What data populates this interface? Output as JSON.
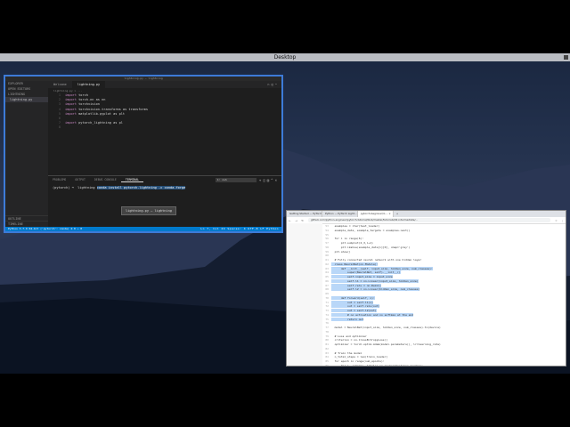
{
  "menubar": {
    "title": "Desktop"
  },
  "vscode": {
    "window_title": "lightning.py — lightning",
    "sidebar": {
      "header": "EXPLORER",
      "open_editors": "OPEN EDITORS",
      "folder": "LIGHTNING",
      "files": [
        "lightning.py"
      ],
      "outline": "OUTLINE",
      "timeline": "TIMELINE"
    },
    "tabs": [
      "Welcome",
      "lightning.py"
    ],
    "breadcrumb": "lightning.py > ...",
    "code_lines": [
      {
        "n": "1",
        "kw": "import",
        "rest": " torch"
      },
      {
        "n": "2",
        "kw": "import",
        "rest": " torch.nn as nn"
      },
      {
        "n": "3",
        "kw": "import",
        "rest": " torchvision"
      },
      {
        "n": "4",
        "kw": "import",
        "rest": " torchvision.transforms as transforms"
      },
      {
        "n": "5",
        "kw": "import",
        "rest": " matplotlib.pyplot as plt"
      },
      {
        "n": "6",
        "kw": "",
        "rest": ""
      },
      {
        "n": "7",
        "kw": "import",
        "rest": " pytorch_lightning as pl"
      },
      {
        "n": "8",
        "kw": "",
        "rest": ""
      }
    ],
    "hover_text": "lightning.py — lightning",
    "panel_tabs": [
      "PROBLEMS",
      "OUTPUT",
      "DEBUG CONSOLE",
      "TERMINAL"
    ],
    "terminal_select": "1: zsh",
    "terminal_prompt": "(pytorch) ➜  lightning ",
    "terminal_command": "conda install pytorch-lightning -c conda-forge",
    "status_left": "Python 3.7.9 64-bit ('pytorch': conda)   ⊗ 0 ⚠ 0",
    "status_right": "Ln 7, Col 24   Spaces: 4   UTF-8   LF   Python"
  },
  "browser": {
    "tabs": [
      "Getting Started — PyTorch",
      "Python — PyTorch Light...",
      "pytorch-beginner/4-... ×"
    ],
    "url": "github.com/python-engineer/pytorch-tutorial/blob/master/tutorials/02-intermediate/...",
    "lines": [
      {
        "n": "53",
        "t": "  examples = iter(test_loader)",
        "sel": false
      },
      {
        "n": "54",
        "t": "  example_data, example_targets = examples.next()",
        "sel": false
      },
      {
        "n": "55",
        "t": "",
        "sel": false
      },
      {
        "n": "56",
        "t": "  for i in range(6):",
        "sel": false
      },
      {
        "n": "57",
        "t": "      plt.subplot(2,3,i+1)",
        "sel": false
      },
      {
        "n": "58",
        "t": "      plt.imshow(example_data[i][0], cmap='gray')",
        "sel": false
      },
      {
        "n": "59",
        "t": "  plt.show()",
        "sel": false
      },
      {
        "n": "60",
        "t": "",
        "sel": false
      },
      {
        "n": "61",
        "t": "  # Fully connected neural network with one hidden layer",
        "sel": false
      },
      {
        "n": "62",
        "t": "  class NeuralNet(nn.Module):",
        "sel": true
      },
      {
        "n": "63",
        "t": "      def __init__(self, input_size, hidden_size, num_classes):",
        "sel": true
      },
      {
        "n": "64",
        "t": "          super(NeuralNet, self).__init__()",
        "sel": true
      },
      {
        "n": "65",
        "t": "          self.input_size = input_size",
        "sel": true
      },
      {
        "n": "66",
        "t": "          self.l1 = nn.Linear(input_size, hidden_size)",
        "sel": true
      },
      {
        "n": "67",
        "t": "          self.relu = nn.ReLU()",
        "sel": true
      },
      {
        "n": "68",
        "t": "          self.l2 = nn.Linear(hidden_size, num_classes)",
        "sel": true
      },
      {
        "n": "69",
        "t": "",
        "sel": false
      },
      {
        "n": "70",
        "t": "      def forward(self, x):",
        "sel": true
      },
      {
        "n": "71",
        "t": "          out = self.l1(x)",
        "sel": true
      },
      {
        "n": "72",
        "t": "          out = self.relu(out)",
        "sel": true
      },
      {
        "n": "73",
        "t": "          out = self.l2(out)",
        "sel": true
      },
      {
        "n": "74",
        "t": "          # no activation and no softmax at the end",
        "sel": true
      },
      {
        "n": "75",
        "t": "          return out",
        "sel": true
      },
      {
        "n": "76",
        "t": "",
        "sel": false
      },
      {
        "n": "77",
        "t": "  model = NeuralNet(input_size, hidden_size, num_classes).to(device)",
        "sel": false
      },
      {
        "n": "78",
        "t": "",
        "sel": false
      },
      {
        "n": "79",
        "t": "  # Loss and optimizer",
        "sel": false
      },
      {
        "n": "80",
        "t": "  criterion = nn.CrossEntropyLoss()",
        "sel": false
      },
      {
        "n": "81",
        "t": "  optimizer = torch.optim.Adam(model.parameters(), lr=learning_rate)",
        "sel": false
      },
      {
        "n": "82",
        "t": "",
        "sel": false
      },
      {
        "n": "83",
        "t": "  # Train the model",
        "sel": false
      },
      {
        "n": "84",
        "t": "  n_total_steps = len(train_loader)",
        "sel": false
      },
      {
        "n": "85",
        "t": "  for epoch in range(num_epochs):",
        "sel": false
      },
      {
        "n": "86",
        "t": "      for i, (images, labels) in enumerate(train_loader):",
        "sel": false
      },
      {
        "n": "87",
        "t": "          # origin shape: [100, 1, 28, 28]",
        "sel": false
      },
      {
        "n": "88",
        "t": "          # resized: [100, 784]",
        "sel": false
      },
      {
        "n": "89",
        "t": "          images = images.reshape(-1, 28*28).to(device)",
        "sel": false
      },
      {
        "n": "90",
        "t": "          labels = labels.to(device)",
        "sel": false
      }
    ]
  }
}
